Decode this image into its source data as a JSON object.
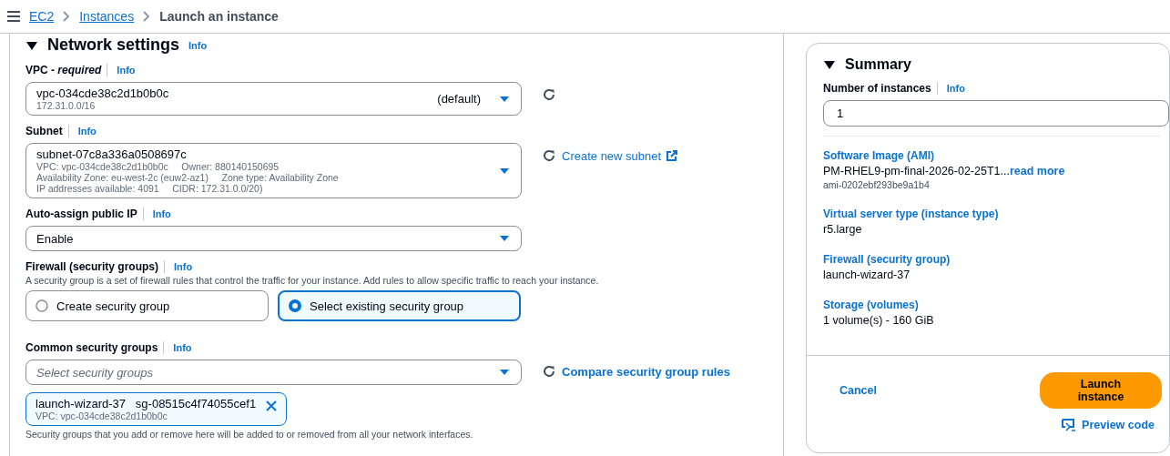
{
  "breadcrumbs": [
    {
      "label": "EC2",
      "kind": "link"
    },
    {
      "label": "Instances",
      "kind": "link"
    },
    {
      "label": "Launch an instance",
      "kind": "current"
    }
  ],
  "network": {
    "title": "Network settings",
    "info": "Info",
    "expanded": true,
    "vpc": {
      "label": "VPC - *required*",
      "info": "Info",
      "value": "vpc-034cde38c2d1b0b0c",
      "suffix": "(default)",
      "details": [
        "172.31.0.0/16"
      ]
    },
    "subnet": {
      "label": "Subnet",
      "info": "Info",
      "value": "subnet-07c8a336a0508697c",
      "details": [
        "VPC: vpc-034cde38c2d1b0b0c     Owner: 880140150695",
        "Availability Zone: eu-west-2c (euw2-az1)     Zone type: Availability Zone",
        "IP addresses available: 4091     CIDR: 172.31.0.0/20)"
      ],
      "link": "Create new subnet"
    },
    "public_ip": {
      "label": "Auto-assign public IP",
      "info": "Info",
      "value": "Enable"
    },
    "firewall": {
      "label": "Firewall (security groups)",
      "info": "Info",
      "description": "A security group is a set of firewall rules that control the traffic for your instance. Add rules to allow specific traffic to reach your instance.",
      "options": [
        {
          "label": "Create security group",
          "selected": false
        },
        {
          "label": "Select existing security group",
          "selected": true
        }
      ]
    },
    "common_groups": {
      "label": "Common security groups",
      "info": "Info",
      "placeholder": "Select security groups",
      "link": "Compare security group rules",
      "tokens": [
        {
          "name": "launch-wizard-37",
          "id": "sg-08515c4f74055cef1",
          "vpc": "VPC: vpc-034cde38c2d1b0b0c"
        }
      ],
      "note": "Security groups that you add or remove here will be added to or removed from all your network interfaces."
    }
  },
  "summary": {
    "title": "Summary",
    "expanded": true,
    "instances": {
      "label": "Number of instances",
      "info": "Info",
      "value": "1"
    },
    "items": [
      {
        "label": "Software Image (AMI)",
        "value": "PM-RHEL9-pm-final-2026-02-25T1...",
        "link": "read more",
        "sub": "ami-0202ebf293be9a1b4"
      },
      {
        "label": "Virtual server type (instance type)",
        "value": "r5.large"
      },
      {
        "label": "Firewall (security group)",
        "value": "launch-wizard-37"
      },
      {
        "label": "Storage (volumes)",
        "value": "1 volume(s) - 160 GiB"
      }
    ],
    "cancel": "Cancel",
    "launch": "Launch instance",
    "preview": "Preview code"
  }
}
